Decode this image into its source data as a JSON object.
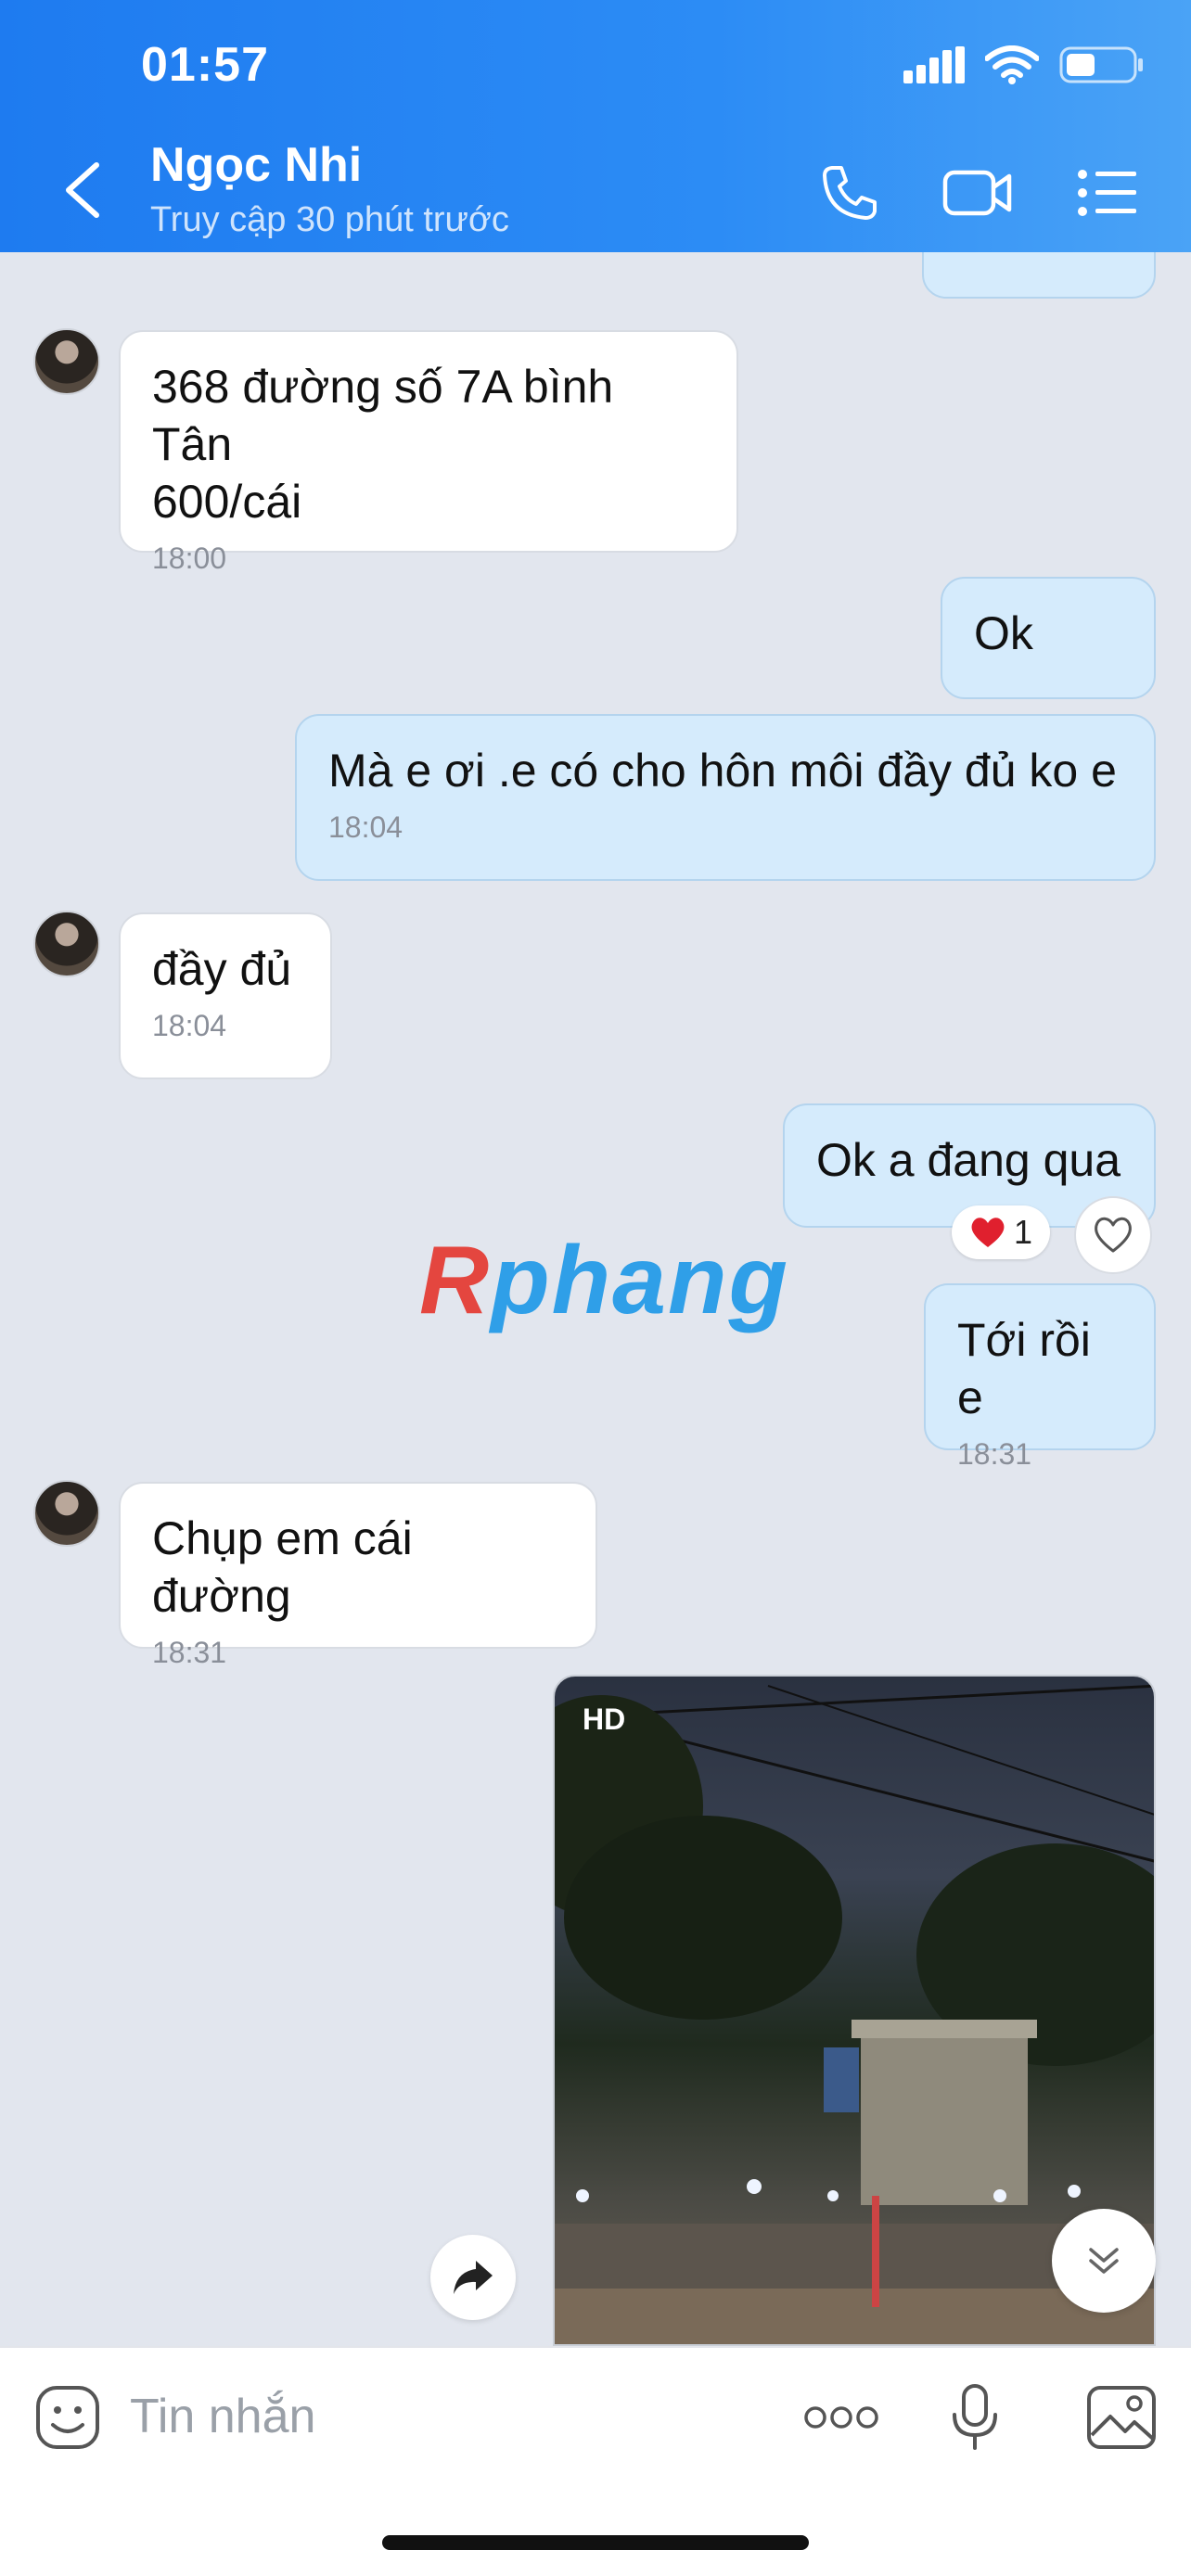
{
  "status": {
    "time": "01:57"
  },
  "header": {
    "name": "Ngọc Nhi",
    "subtitle": "Truy cập 30 phút trước"
  },
  "messages": [
    {
      "text": "368 đường số 7A bình Tân\n600/cái",
      "time": "18:00",
      "from": "contact"
    },
    {
      "text": "Ok",
      "time": "",
      "from": "me"
    },
    {
      "text": "Mà e ơi .e có cho hôn môi đầy đủ ko e",
      "time": "18:04",
      "from": "me"
    },
    {
      "text": "đầy đủ",
      "time": "18:04",
      "from": "contact"
    },
    {
      "text": "Ok a đang qua",
      "time": "",
      "from": "me",
      "reaction_count": "1"
    },
    {
      "text": "Tới rồi e",
      "time": "18:31",
      "from": "me"
    },
    {
      "text": "Chụp em cái đường",
      "time": "18:31",
      "from": "contact"
    }
  ],
  "photo": {
    "badge": "HD"
  },
  "watermark": {
    "first": "R",
    "rest": "phang"
  },
  "composer": {
    "placeholder": "Tin nhắn"
  },
  "icons": {
    "back": "chevron-left-icon",
    "call": "phone-icon",
    "video": "video-camera-icon",
    "menu": "list-menu-icon",
    "sticker": "smiley-icon",
    "more": "more-dots-icon",
    "mic": "microphone-icon",
    "gallery": "image-icon",
    "share": "share-arrow-icon",
    "scroll": "double-chevron-down-icon",
    "like": "heart-icon"
  },
  "colors": {
    "header": "#2c8cf5",
    "outgoing": "#d5ebfc",
    "incoming": "#ffffff",
    "background": "#e2e6ee"
  }
}
